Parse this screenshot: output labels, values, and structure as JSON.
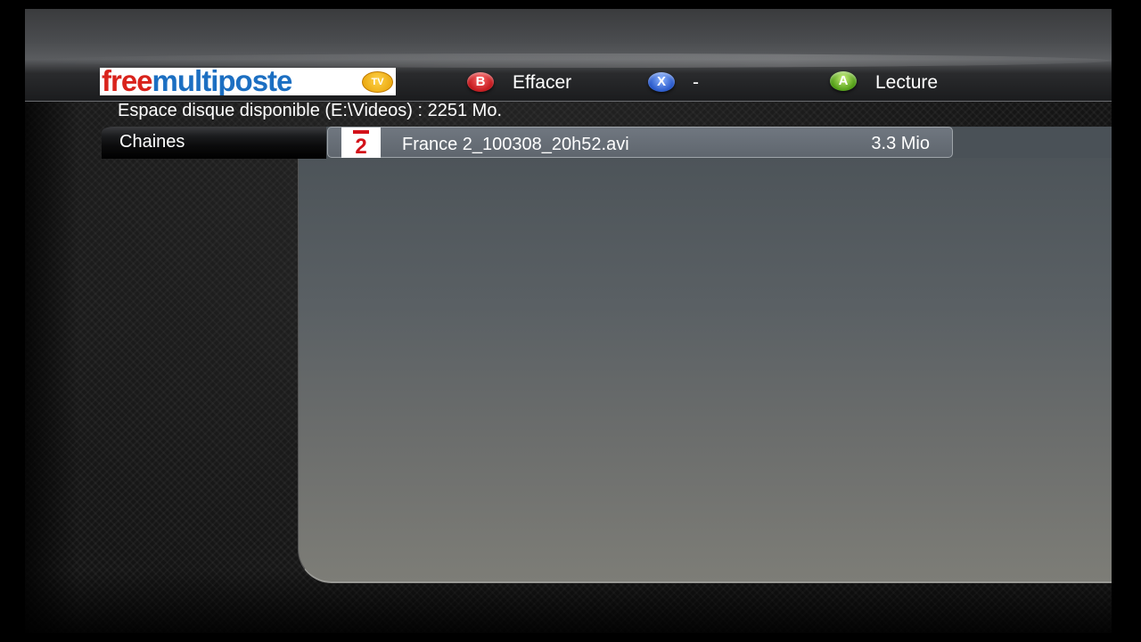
{
  "header": {
    "logo_text_red": "free",
    "logo_text_blue": "multiposte",
    "logo_badge": "TV"
  },
  "actions": [
    {
      "button": "B",
      "label": "Effacer",
      "color": "#c0151a"
    },
    {
      "button": "X",
      "label": "-",
      "color": "#2455c8"
    },
    {
      "button": "A",
      "label": "Lecture",
      "color": "#4c9a12"
    }
  ],
  "disk_info": "Espace disque disponible (E:\\Videos) : 2251 Mo.",
  "sidebar": {
    "items": [
      {
        "label": "Chaines",
        "selected": true
      }
    ]
  },
  "files": [
    {
      "channel_icon": "france2-logo",
      "channel_number": "2",
      "name": "France 2_100308_20h52.avi",
      "size": "3.3 Mio",
      "selected": true
    }
  ]
}
